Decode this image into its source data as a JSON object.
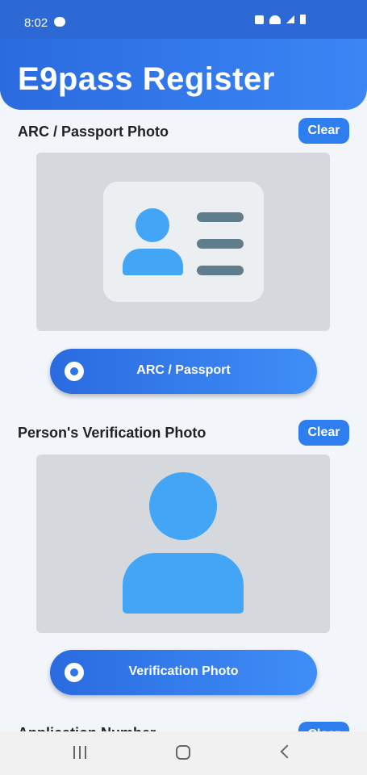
{
  "status_bar": {
    "time": "8:02"
  },
  "header": {
    "title": "E9pass Register"
  },
  "sections": [
    {
      "title": "ARC / Passport Photo",
      "clear_label": "Clear",
      "button_label": "ARC / Passport"
    },
    {
      "title": "Person's Verification Photo",
      "clear_label": "Clear",
      "button_label": "Verification Photo"
    },
    {
      "title": "Application Number",
      "clear_label": "Clear"
    }
  ],
  "colors": {
    "primary": "#2f7ef0",
    "illustration_blue": "#42a5f5",
    "illustration_grey": "#607d8b"
  },
  "icons": [
    "camera-shutter-icon",
    "id-card-icon",
    "person-icon"
  ]
}
